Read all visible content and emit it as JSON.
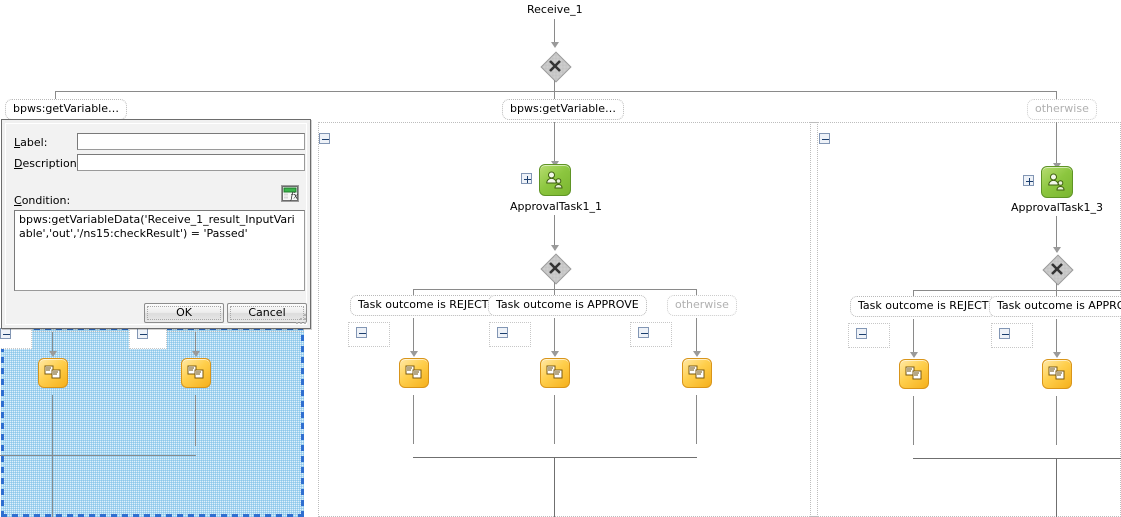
{
  "diagram": {
    "start_node_label": "Receive_1",
    "top_branch_labels": [
      "bpws:getVariable…",
      "bpws:getVariable…",
      "otherwise"
    ],
    "approval_tasks": [
      {
        "label": "ApprovalTask1_1",
        "expander": "+"
      },
      {
        "label": "ApprovalTask1_3",
        "expander": "+"
      }
    ],
    "outcome_labels_center": [
      "Task outcome is REJECT",
      "Task outcome is APPROVE",
      "otherwise"
    ],
    "outcome_labels_right": [
      "Task outcome is REJECT",
      "Task outcome is APPROVE"
    ],
    "gateway_glyph": "X",
    "collapse_glyph": "-",
    "expand_glyph": "+",
    "colors": {
      "selection_fill": "#dff0fb",
      "selection_border": "#2f6fd0",
      "human_task": "#8cc63f",
      "task": "#ffcf4d",
      "gateway": "#d2d2d2",
      "connector": "#8a8a8a"
    }
  },
  "dialog": {
    "label_field": {
      "label": "Label:",
      "accel": "L",
      "value": "",
      "placeholder": ""
    },
    "description_field": {
      "label": "Description:",
      "accel": "D",
      "value": "",
      "placeholder": ""
    },
    "condition_field": {
      "label": "Condition:",
      "accel": "C",
      "value": "bpws:getVariableData('Receive_1_result_InputVariable','out','/ns15:checkResult') = 'Passed'"
    },
    "expression_builder": {
      "title": "fx",
      "icon": "formula-builder-icon"
    },
    "ok_label": "OK",
    "cancel_label": "Cancel"
  }
}
